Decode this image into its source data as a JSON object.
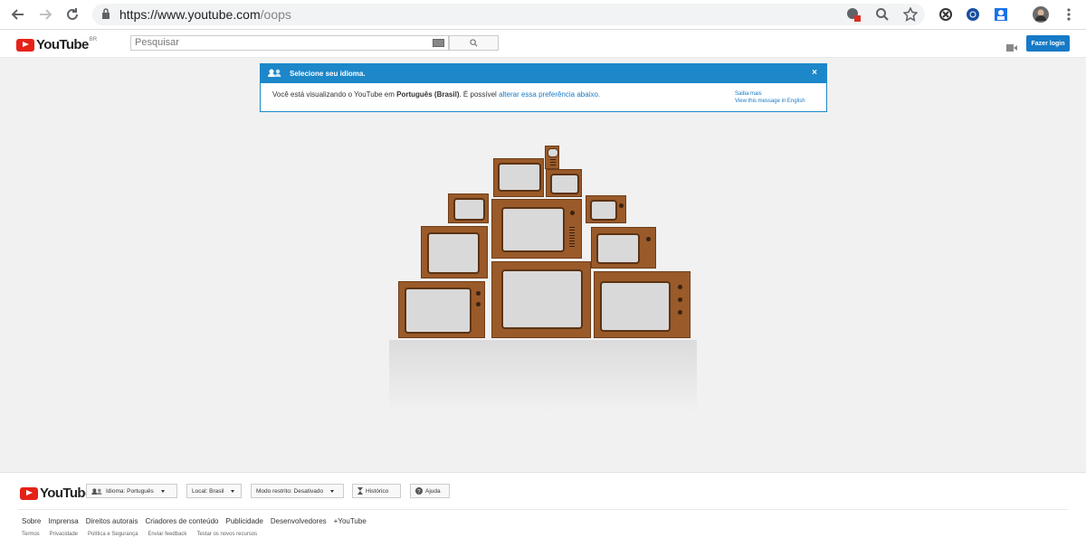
{
  "browser": {
    "url_host": "https://www.youtube.com",
    "url_path": "/oops"
  },
  "header": {
    "logo_text": "YouTube",
    "country_code": "BR",
    "search_placeholder": "Pesquisar",
    "login_label": "Fazer login"
  },
  "banner": {
    "title": "Selecione seu idioma.",
    "close": "×",
    "message_prefix": "Você está visualizando o YouTube em ",
    "language": "Português (Brasil)",
    "message_middle": ". É possível ",
    "change_link": "alterar essa preferência abaixo.",
    "learn_more": "Saiba mais",
    "view_english": "View this message in English"
  },
  "footer": {
    "logo_text": "YouTube",
    "buttons": [
      {
        "label": "Idioma: Português"
      },
      {
        "label": "Local: Brasil"
      },
      {
        "label": "Modo restrito: Desativado"
      },
      {
        "label": "Histórico"
      },
      {
        "label": "Ajuda"
      }
    ],
    "links": [
      "Sobre",
      "Imprensa",
      "Direitos autorais",
      "Criadores de conteúdo",
      "Publicidade",
      "Desenvolvedores",
      "+YouTube"
    ],
    "sub_links": [
      "Termos",
      "Privacidade",
      "Política e Segurança",
      "Enviar feedback",
      "Testar os novos recursos"
    ]
  },
  "colors": {
    "accent": "#167ac6",
    "banner": "#1c87c9",
    "brand_red": "#e62117"
  }
}
